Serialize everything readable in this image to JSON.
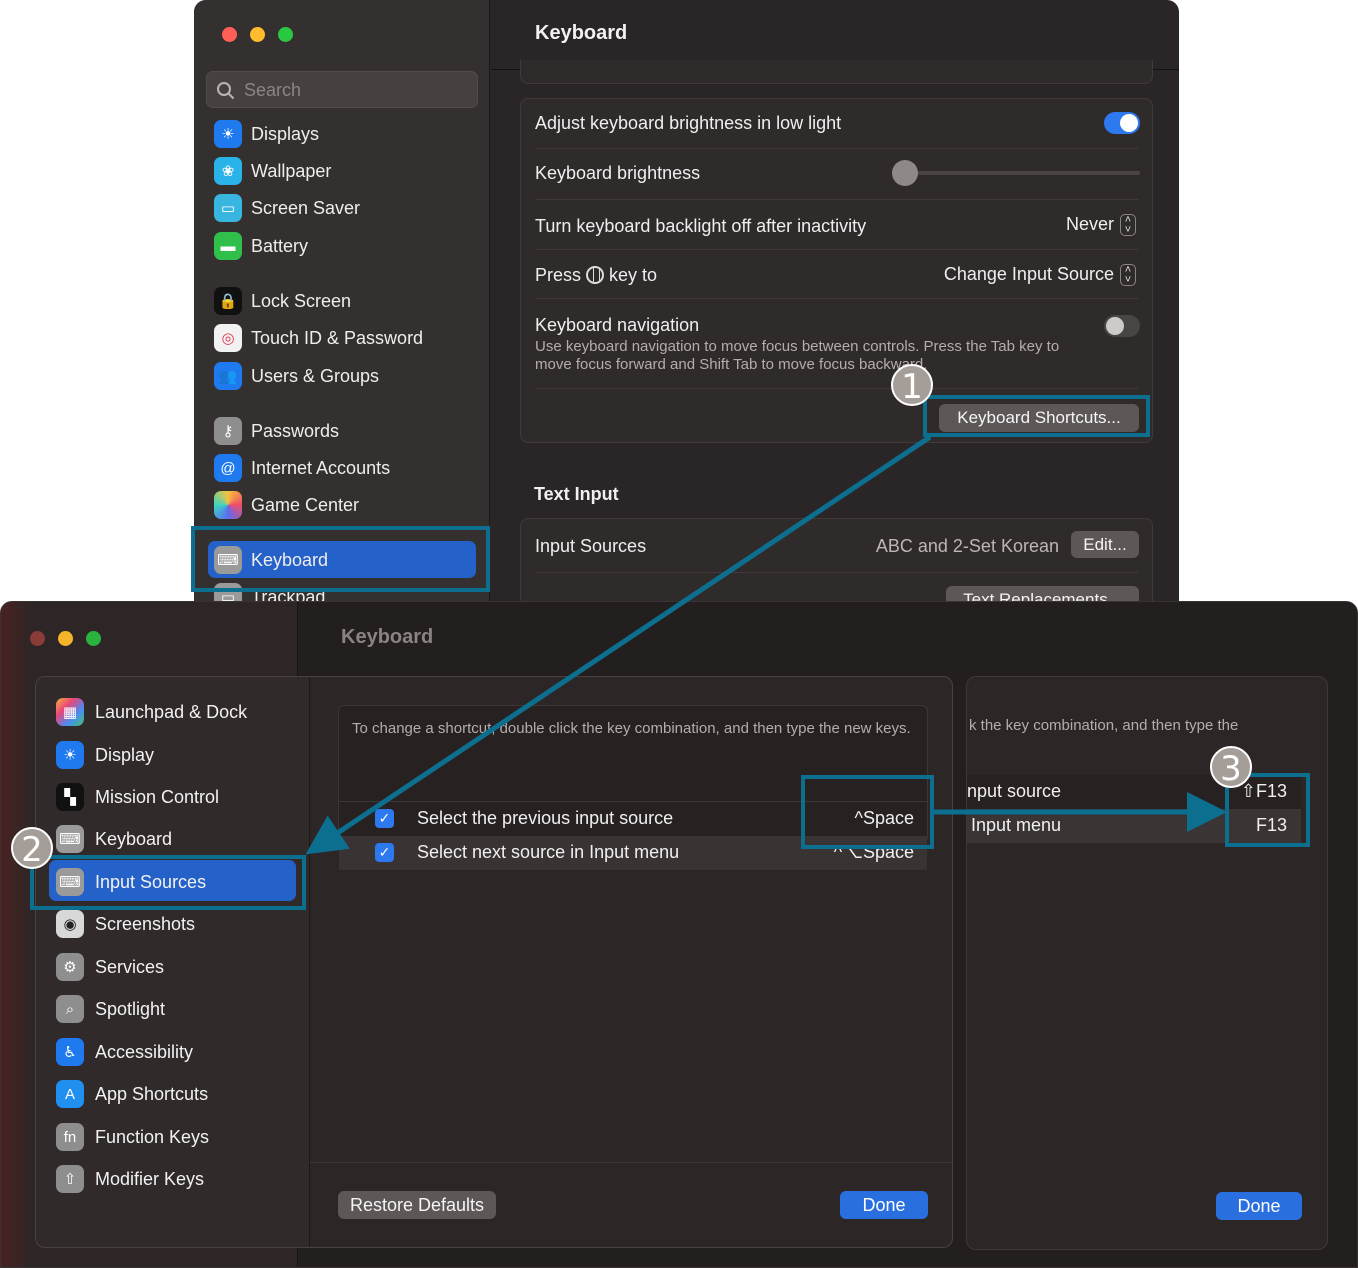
{
  "top_window": {
    "title": "Keyboard",
    "search_placeholder": "Search",
    "sidebar": [
      {
        "label": "Displays",
        "icon": "sun-icon"
      },
      {
        "label": "Wallpaper",
        "icon": "flower-icon"
      },
      {
        "label": "Screen Saver",
        "icon": "screen-saver-icon"
      },
      {
        "label": "Battery",
        "icon": "battery-icon"
      },
      {
        "label": "Lock Screen",
        "icon": "lock-icon"
      },
      {
        "label": "Touch ID & Password",
        "icon": "fingerprint-icon"
      },
      {
        "label": "Users & Groups",
        "icon": "users-icon"
      },
      {
        "label": "Passwords",
        "icon": "key-icon"
      },
      {
        "label": "Internet Accounts",
        "icon": "at-icon"
      },
      {
        "label": "Game Center",
        "icon": "game-center-icon"
      },
      {
        "label": "Keyboard",
        "icon": "keyboard-icon"
      },
      {
        "label": "Trackpad",
        "icon": "trackpad-icon"
      }
    ],
    "settings": {
      "adjust_brightness_label": "Adjust keyboard brightness in low light",
      "adjust_brightness_on": true,
      "brightness_label": "Keyboard brightness",
      "brightness_level": 0,
      "backlight_off_label": "Turn keyboard backlight off after inactivity",
      "backlight_off_value": "Never",
      "press_key_label_pre": "Press",
      "press_key_label_post": "key to",
      "press_key_value": "Change Input Source",
      "nav_label": "Keyboard navigation",
      "nav_desc": "Use keyboard navigation to move focus between controls. Press the Tab key to move focus forward and Shift Tab to move focus backward.",
      "nav_on": false,
      "shortcuts_button": "Keyboard Shortcuts..."
    },
    "text_input": {
      "heading": "Text Input",
      "input_sources_label": "Input Sources",
      "input_sources_value": "ABC and 2-Set Korean",
      "edit_button": "Edit...",
      "text_replacements_button": "Text Replacements..."
    }
  },
  "bottom_window": {
    "title": "Keyboard",
    "sheet_sidebar": [
      {
        "label": "Launchpad & Dock",
        "icon": "launchpad-icon"
      },
      {
        "label": "Display",
        "icon": "sun-icon"
      },
      {
        "label": "Mission Control",
        "icon": "mission-control-icon"
      },
      {
        "label": "Keyboard",
        "icon": "keyboard-icon"
      },
      {
        "label": "Input Sources",
        "icon": "keyboard-icon"
      },
      {
        "label": "Screenshots",
        "icon": "camera-icon"
      },
      {
        "label": "Services",
        "icon": "gear-icon"
      },
      {
        "label": "Spotlight",
        "icon": "magnifier-icon"
      },
      {
        "label": "Accessibility",
        "icon": "accessibility-icon"
      },
      {
        "label": "App Shortcuts",
        "icon": "app-store-icon"
      },
      {
        "label": "Function Keys",
        "icon": "fn-icon"
      },
      {
        "label": "Modifier Keys",
        "icon": "arrow-up-icon"
      }
    ],
    "hint": "To change a shortcut, double click the key combination, and then type the new keys.",
    "shortcuts": [
      {
        "label": "Select the previous input source",
        "key": "^Space",
        "checked": true
      },
      {
        "label": "Select next source in Input menu",
        "key": "^⌥Space",
        "checked": true
      }
    ],
    "restore_button": "Restore Defaults",
    "done_button": "Done",
    "back_sheet": {
      "hint_fragment": "k the key combination, and then type the",
      "row1_fragment": "nput source",
      "row1_key": "⇧F13",
      "row2_fragment": "Input menu",
      "row2_key": "F13",
      "done_button": "Done"
    }
  },
  "annotations": {
    "badge1": "1",
    "badge2": "2",
    "badge3": "3"
  }
}
